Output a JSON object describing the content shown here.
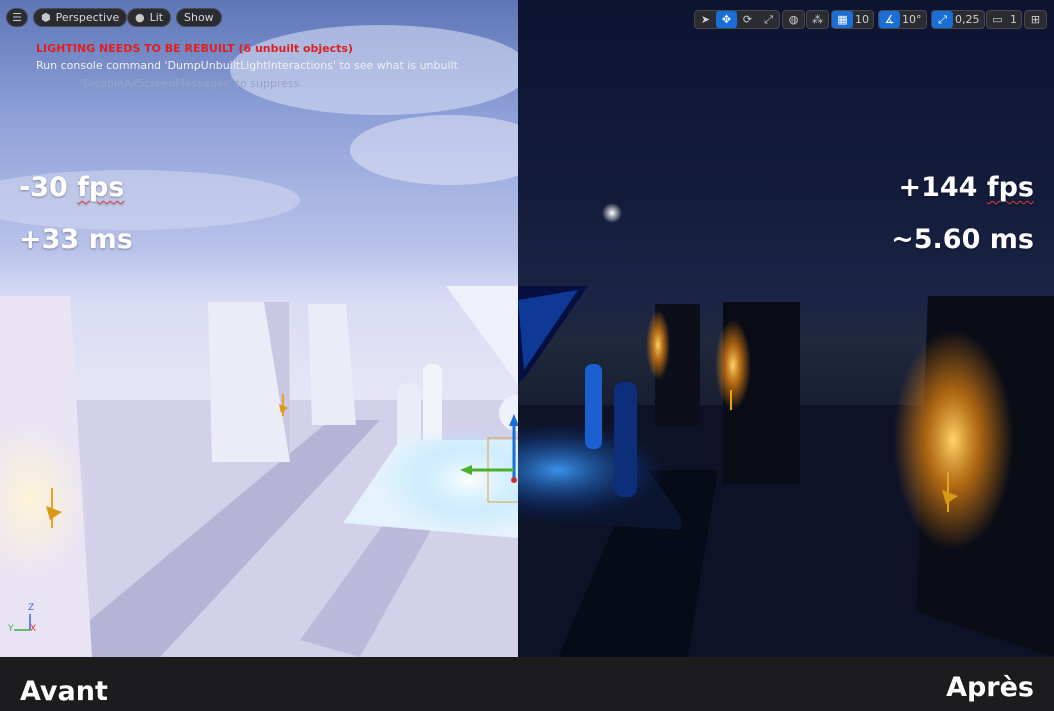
{
  "viewport": {
    "toolbar_left": {
      "menu_icon": "hamburger-icon",
      "perspective_label": "Perspective",
      "lit_label": "Lit",
      "show_label": "Show"
    },
    "messages": {
      "rebuild_warning": "LIGHTING NEEDS TO BE REBUILT (6 unbuilt objects)",
      "console_hint": "Run console command 'DumpUnbuiltLightInteractions' to see what is unbuilt",
      "suppress_hint": "'DisableAllScreenMessages' to suppress"
    },
    "toolbar_right": {
      "grid_snap_value": "10",
      "rotation_snap_value": "10°",
      "scale_snap_value": "0,25",
      "camera_speed_value": "1"
    },
    "axis_labels": {
      "z": "Z",
      "y": "Y",
      "x": "X"
    }
  },
  "comparison": {
    "before": {
      "fps_value": "-30",
      "fps_unit": "fps",
      "ms": "+33 ms",
      "label": "Avant"
    },
    "after": {
      "fps_value": "+144",
      "fps_unit": "fps",
      "ms": "~5.60 ms",
      "label": "Après"
    }
  },
  "colors": {
    "active_tool": "#1a6fd6",
    "warning_text": "#e02020",
    "before_sky": "#8fa1d8",
    "after_sky": "#141c3c"
  }
}
